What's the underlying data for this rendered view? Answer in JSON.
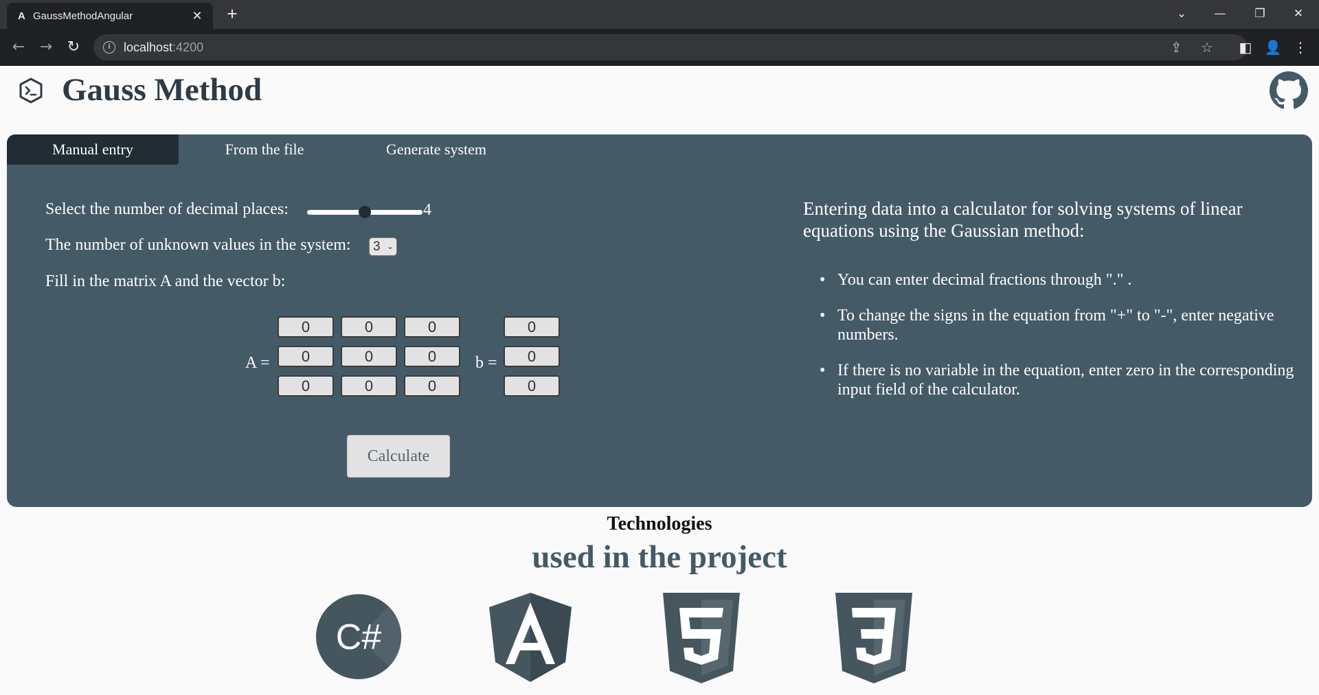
{
  "browser": {
    "tab_title": "GaussMethodAngular",
    "tab_favicon": "A",
    "url_host": "localhost",
    "url_port": ":4200"
  },
  "header": {
    "title": "Gauss Method",
    "logo_icon": "terminal-icon",
    "github_icon": "github-icon"
  },
  "tabs": [
    {
      "label": "Manual entry",
      "active": true
    },
    {
      "label": "From the file",
      "active": false
    },
    {
      "label": "Generate system",
      "active": false
    }
  ],
  "form": {
    "decimal_label": "Select the number of decimal places:",
    "decimal_value": "4",
    "decimal_slider_fraction": 0.5,
    "unknowns_label": "The number of unknown values in the system:",
    "unknowns_value": "3",
    "fill_label": "Fill in the matrix A and the vector b:",
    "matrix_label": "A =",
    "vector_label": "b =",
    "matrix_a": [
      [
        "0",
        "0",
        "0"
      ],
      [
        "0",
        "0",
        "0"
      ],
      [
        "0",
        "0",
        "0"
      ]
    ],
    "vector_b": [
      "0",
      "0",
      "0"
    ],
    "calculate_label": "Calculate"
  },
  "info": {
    "title": "Entering data into a calculator for solving systems of linear equations using the Gaussian method:",
    "bullets": [
      "You can enter decimal fractions through \".\" .",
      "To change the signs in the equation from \"+\" to \"-\", enter negative numbers.",
      "If there is no variable in the equation, enter zero in the corresponding input field of the calculator."
    ]
  },
  "technologies": {
    "title": "Technologies",
    "subtitle": "used in the project",
    "csharp_text": "C#",
    "logos": [
      "csharp-icon",
      "angular-icon",
      "html5-icon",
      "css3-icon"
    ]
  },
  "colors": {
    "panel": "#455a67",
    "active_tab": "#212c33",
    "title": "#2f3b44"
  }
}
